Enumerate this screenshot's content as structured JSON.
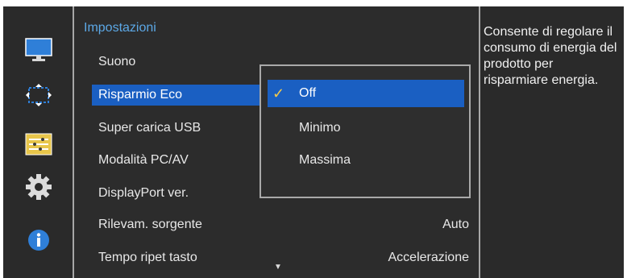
{
  "sidebar": {
    "icons": [
      "monitor-icon",
      "move-arrows-icon",
      "adjust-sliders-icon",
      "gear-icon",
      "info-icon"
    ]
  },
  "main": {
    "title": "Impostazioni",
    "items": [
      {
        "label": "Suono",
        "value": ""
      },
      {
        "label": "Risparmio Eco",
        "value": ""
      },
      {
        "label": "Super carica USB",
        "value": ""
      },
      {
        "label": "Modalità PC/AV",
        "value": ""
      },
      {
        "label": "DisplayPort ver.",
        "value": ""
      },
      {
        "label": "Rilevam. sorgente",
        "value": "Auto"
      },
      {
        "label": "Tempo ripet tasto",
        "value": "Accelerazione"
      }
    ],
    "scroll_indicator": "▼"
  },
  "dropdown": {
    "options": [
      {
        "label": "Off",
        "checked": true
      },
      {
        "label": "Minimo",
        "checked": false
      },
      {
        "label": "Massima",
        "checked": false
      }
    ],
    "check_glyph": "✓"
  },
  "description": "Consente di regolare il consumo di energia del prodotto per risparmiare energia.",
  "colors": {
    "accent": "#1a5fc2",
    "title": "#5ca8e6",
    "background": "#2c2c2c"
  }
}
